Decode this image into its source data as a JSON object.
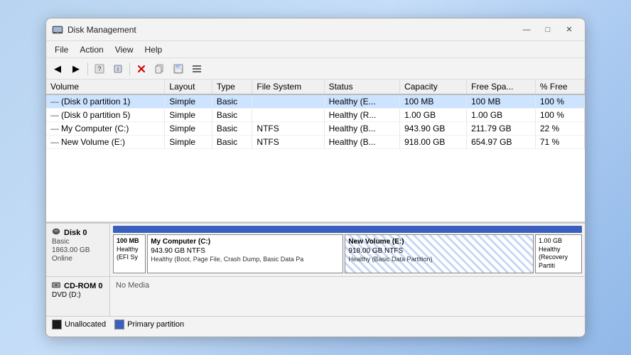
{
  "window": {
    "title": "Disk Management",
    "controls": {
      "minimize": "—",
      "maximize": "□",
      "close": "✕"
    }
  },
  "menu": {
    "items": [
      "File",
      "Action",
      "View",
      "Help"
    ]
  },
  "toolbar": {
    "buttons": [
      "◀",
      "▶",
      "📄",
      "❓",
      "🔧",
      "✕",
      "📋",
      "💾",
      "🖼"
    ]
  },
  "table": {
    "columns": [
      "Volume",
      "Layout",
      "Type",
      "File System",
      "Status",
      "Capacity",
      "Free Spa...",
      "% Free"
    ],
    "rows": [
      {
        "volume": "(Disk 0 partition 1)",
        "layout": "Simple",
        "type": "Basic",
        "filesystem": "",
        "status": "Healthy (E...",
        "capacity": "100 MB",
        "free_space": "100 MB",
        "percent_free": "100 %"
      },
      {
        "volume": "(Disk 0 partition 5)",
        "layout": "Simple",
        "type": "Basic",
        "filesystem": "",
        "status": "Healthy (R...",
        "capacity": "1.00 GB",
        "free_space": "1.00 GB",
        "percent_free": "100 %"
      },
      {
        "volume": "My Computer (C:)",
        "layout": "Simple",
        "type": "Basic",
        "filesystem": "NTFS",
        "status": "Healthy (B...",
        "capacity": "943.90 GB",
        "free_space": "211.79 GB",
        "percent_free": "22 %"
      },
      {
        "volume": "New Volume (E:)",
        "layout": "Simple",
        "type": "Basic",
        "filesystem": "NTFS",
        "status": "Healthy (B...",
        "capacity": "918.00 GB",
        "free_space": "654.97 GB",
        "percent_free": "71 %"
      }
    ]
  },
  "disk_panel": {
    "disk0": {
      "label": "Disk 0",
      "type": "Basic",
      "size": "1863.00 GB",
      "status": "Online",
      "partitions": [
        {
          "label": "100 MB",
          "sublabel": "Healthy (EFI Sy",
          "width": "5",
          "type": "primary"
        },
        {
          "label": "My Computer  (C:)",
          "sublabel": "943.90 GB NTFS",
          "detail": "Healthy (Boot, Page File, Crash Dump, Basic Data Pa",
          "width": "48",
          "type": "primary"
        },
        {
          "label": "New Volume  (E:)",
          "sublabel": "918.00 GB NTFS",
          "detail": "Healthy (Basic Data Partition)",
          "width": "42",
          "type": "striped"
        },
        {
          "label": "1.00 GB",
          "sublabel": "Healthy (Recovery Partiti",
          "width": "5",
          "type": "primary"
        }
      ]
    },
    "cdrom0": {
      "label": "CD-ROM 0",
      "type": "DVD (D:)",
      "status": "No Media"
    }
  },
  "legend": {
    "items": [
      {
        "type": "unallocated",
        "label": "Unallocated"
      },
      {
        "type": "primary",
        "label": "Primary partition"
      }
    ]
  }
}
